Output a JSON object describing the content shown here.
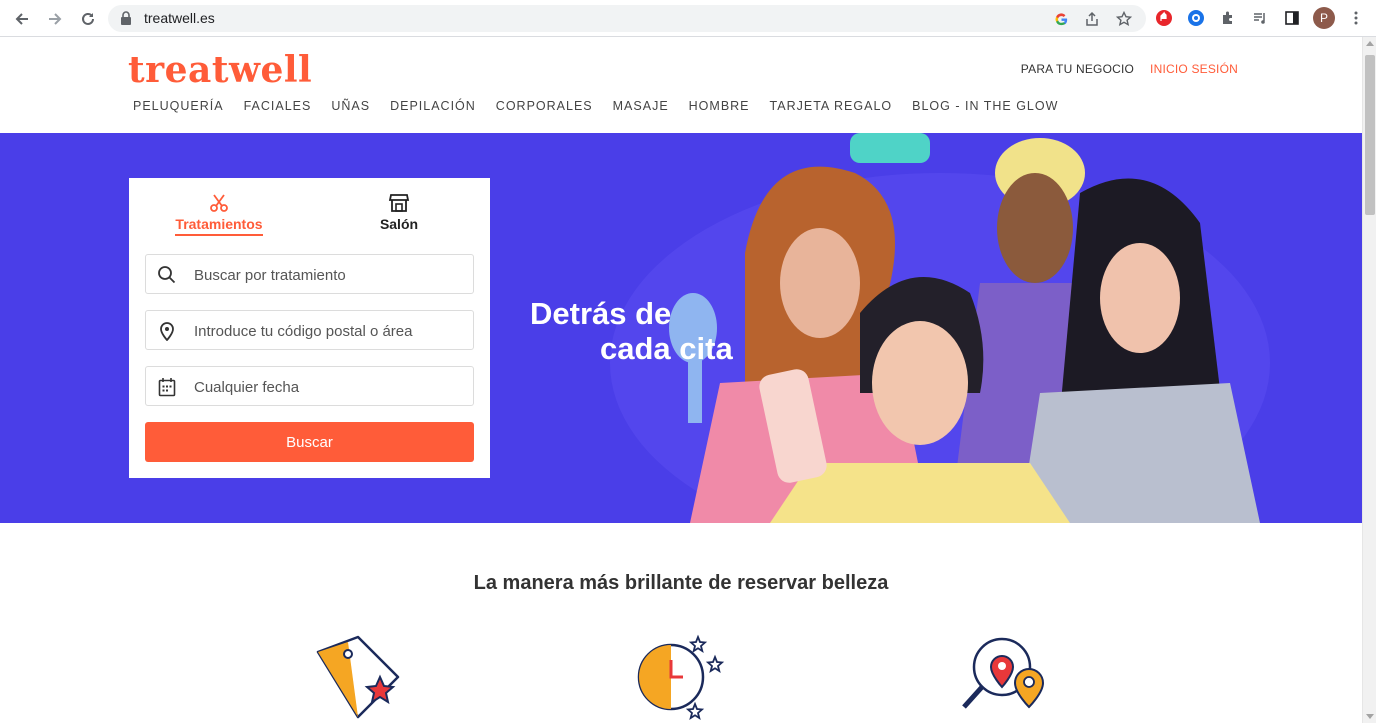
{
  "browser": {
    "url": "treatwell.es",
    "profile_initial": "P"
  },
  "brand": {
    "logo_text": "treatwell",
    "accent": "#ff5c39",
    "hero_bg": "#4a3ee8"
  },
  "header": {
    "business_link": "PARA TU NEGOCIO",
    "login_link": "INICIO SESIÓN",
    "nav": [
      "PELUQUERÍA",
      "FACIALES",
      "UÑAS",
      "DEPILACIÓN",
      "CORPORALES",
      "MASAJE",
      "HOMBRE",
      "TARJETA REGALO",
      "BLOG - IN THE GLOW"
    ]
  },
  "search": {
    "tabs": [
      {
        "label": "Tratamientos",
        "icon": "scissors-icon",
        "active": true
      },
      {
        "label": "Salón",
        "icon": "store-icon",
        "active": false
      }
    ],
    "treatment_placeholder": "Buscar por tratamiento",
    "location_placeholder": "Introduce tu código postal o área",
    "date_placeholder": "Cualquier fecha",
    "button_label": "Buscar"
  },
  "hero": {
    "tagline_line1": "Detrás de",
    "tagline_line2": "cada cita"
  },
  "section": {
    "title": "La manera más brillante de reservar belleza",
    "features": [
      {
        "icon": "price-tag-star-icon"
      },
      {
        "icon": "clock-stars-icon"
      },
      {
        "icon": "location-search-icon"
      }
    ]
  }
}
